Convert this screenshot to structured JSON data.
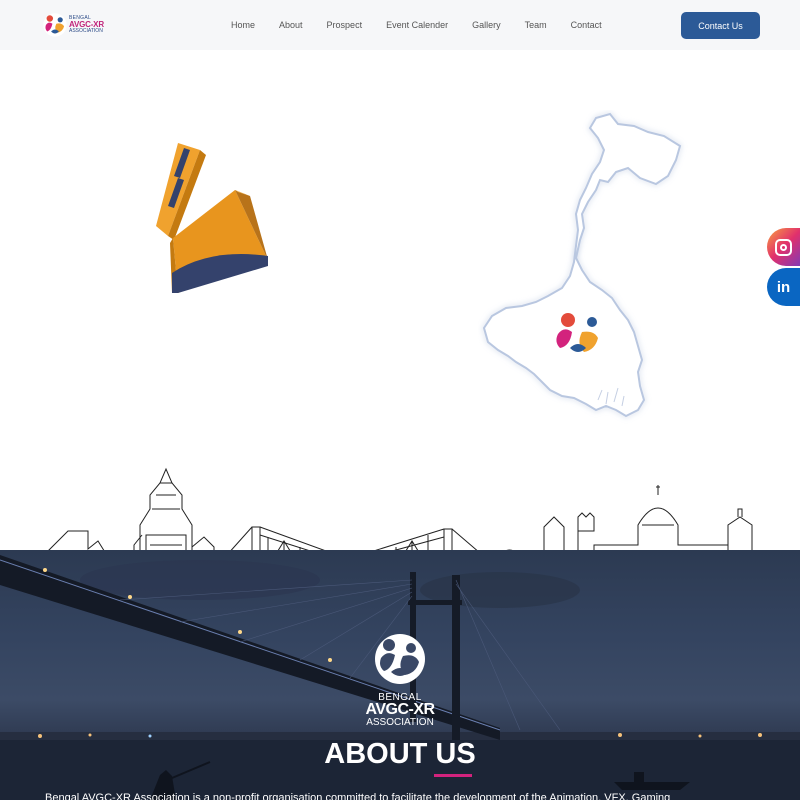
{
  "brand": {
    "line1": "BENGAL",
    "line2": "AVGC-XR",
    "line3": "ASSOCIATION",
    "colors": {
      "primary": "#2c5a97",
      "accent": "#d3237d",
      "orange": "#f0a22e"
    }
  },
  "nav": {
    "items": [
      {
        "label": "Home"
      },
      {
        "label": "About"
      },
      {
        "label": "Prospect"
      },
      {
        "label": "Event Calender"
      },
      {
        "label": "Gallery"
      },
      {
        "label": "Team"
      },
      {
        "label": "Contact"
      }
    ],
    "cta_label": "Contact Us"
  },
  "social": {
    "instagram_icon": "instagram-icon",
    "linkedin_label": "in"
  },
  "about": {
    "logo_line1": "BENGAL",
    "logo_line2": "AVGC-XR",
    "logo_line3": "ASSOCIATION",
    "title": "ABOUT US",
    "description": "Bengal AVGC-XR Association is a non-profit organisation committed to facilitate the development of the Animation, VFX, Gaming"
  }
}
